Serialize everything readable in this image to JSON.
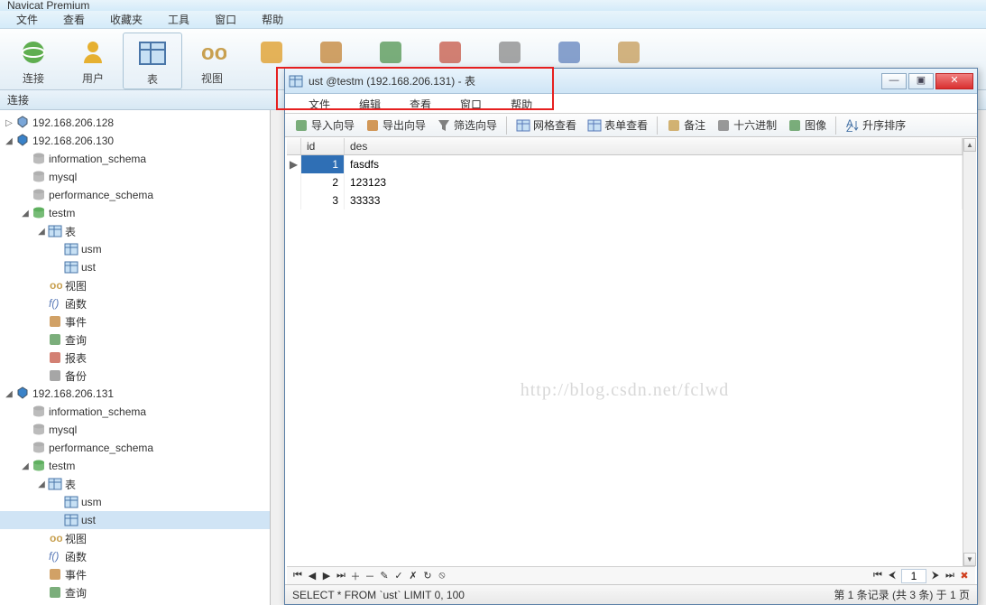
{
  "app_title": "Navicat Premium",
  "main_menu": [
    "文件",
    "查看",
    "收藏夹",
    "工具",
    "窗口",
    "帮助"
  ],
  "main_tools": [
    {
      "label": "连接",
      "icon": "globe"
    },
    {
      "label": "用户",
      "icon": "user"
    },
    {
      "label": "表",
      "icon": "table",
      "active": true
    },
    {
      "label": "视图",
      "icon": "view"
    },
    {
      "label": "",
      "icon": "proc"
    },
    {
      "label": "",
      "icon": "event"
    },
    {
      "label": "",
      "icon": "query"
    },
    {
      "label": "",
      "icon": "report"
    },
    {
      "label": "",
      "icon": "backup"
    },
    {
      "label": "",
      "icon": "schedule"
    },
    {
      "label": "",
      "icon": "model"
    }
  ],
  "sidebar_header": "连接",
  "tree": [
    {
      "d": 0,
      "exp": "▷",
      "icon": "conn",
      "label": "192.168.206.128"
    },
    {
      "d": 0,
      "exp": "◢",
      "icon": "conn-on",
      "label": "192.168.206.130"
    },
    {
      "d": 1,
      "exp": "",
      "icon": "db",
      "label": "information_schema"
    },
    {
      "d": 1,
      "exp": "",
      "icon": "db",
      "label": "mysql"
    },
    {
      "d": 1,
      "exp": "",
      "icon": "db",
      "label": "performance_schema"
    },
    {
      "d": 1,
      "exp": "◢",
      "icon": "db-on",
      "label": "testm"
    },
    {
      "d": 2,
      "exp": "◢",
      "icon": "tables",
      "label": "表"
    },
    {
      "d": 3,
      "exp": "",
      "icon": "table",
      "label": "usm"
    },
    {
      "d": 3,
      "exp": "",
      "icon": "table",
      "label": "ust"
    },
    {
      "d": 2,
      "exp": "",
      "icon": "view",
      "label": "视图"
    },
    {
      "d": 2,
      "exp": "",
      "icon": "func",
      "label": "函数"
    },
    {
      "d": 2,
      "exp": "",
      "icon": "event",
      "label": "事件"
    },
    {
      "d": 2,
      "exp": "",
      "icon": "query",
      "label": "查询"
    },
    {
      "d": 2,
      "exp": "",
      "icon": "report",
      "label": "报表"
    },
    {
      "d": 2,
      "exp": "",
      "icon": "backup",
      "label": "备份"
    },
    {
      "d": 0,
      "exp": "◢",
      "icon": "conn-on",
      "label": "192.168.206.131"
    },
    {
      "d": 1,
      "exp": "",
      "icon": "db",
      "label": "information_schema"
    },
    {
      "d": 1,
      "exp": "",
      "icon": "db",
      "label": "mysql"
    },
    {
      "d": 1,
      "exp": "",
      "icon": "db",
      "label": "performance_schema"
    },
    {
      "d": 1,
      "exp": "◢",
      "icon": "db-on",
      "label": "testm"
    },
    {
      "d": 2,
      "exp": "◢",
      "icon": "tables",
      "label": "表"
    },
    {
      "d": 3,
      "exp": "",
      "icon": "table",
      "label": "usm"
    },
    {
      "d": 3,
      "exp": "",
      "icon": "table",
      "label": "ust",
      "sel": true
    },
    {
      "d": 2,
      "exp": "",
      "icon": "view",
      "label": "视图"
    },
    {
      "d": 2,
      "exp": "",
      "icon": "func",
      "label": "函数"
    },
    {
      "d": 2,
      "exp": "",
      "icon": "event",
      "label": "事件"
    },
    {
      "d": 2,
      "exp": "",
      "icon": "query",
      "label": "查询"
    }
  ],
  "sub_title": "ust @testm (192.168.206.131) - 表",
  "sub_menu": [
    "文件",
    "编辑",
    "查看",
    "窗口",
    "帮助"
  ],
  "sub_tools": [
    {
      "label": "导入向导",
      "icon": "import"
    },
    {
      "label": "导出向导",
      "icon": "export"
    },
    {
      "label": "筛选向导",
      "icon": "filter",
      "sep": true
    },
    {
      "label": "网格查看",
      "icon": "grid"
    },
    {
      "label": "表单查看",
      "icon": "form",
      "sep": true
    },
    {
      "label": "备注",
      "icon": "memo"
    },
    {
      "label": "十六进制",
      "icon": "hex"
    },
    {
      "label": "图像",
      "icon": "image",
      "sep": true
    },
    {
      "label": "升序排序",
      "icon": "sortasc"
    }
  ],
  "grid_cols": [
    "id",
    "des"
  ],
  "grid_rows": [
    {
      "id": "1",
      "des": "fasdfs",
      "sel": true
    },
    {
      "id": "2",
      "des": "123123"
    },
    {
      "id": "3",
      "des": "33333"
    }
  ],
  "watermark": "http://blog.csdn.net/fclwd",
  "nav_page": "1",
  "status_sql": "SELECT * FROM `ust` LIMIT 0, 100",
  "status_info": "第 1 条记录 (共 3 条) 于 1 页"
}
